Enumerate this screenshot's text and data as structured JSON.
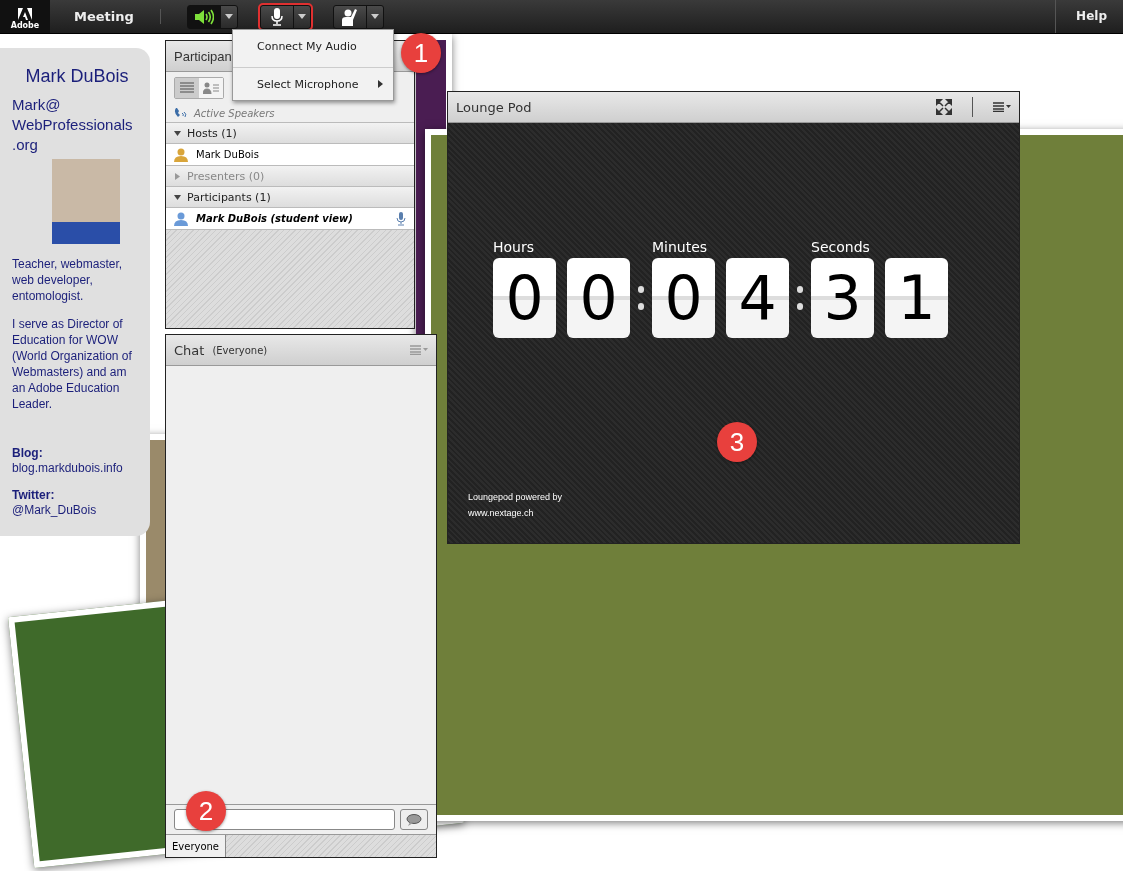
{
  "top_bar": {
    "logo": "Adobe",
    "menu": "Meeting",
    "help": "Help",
    "buttons": [
      {
        "kind": "speaker",
        "on": true,
        "highlighted": false
      },
      {
        "kind": "microphone",
        "on": false,
        "highlighted": true
      },
      {
        "kind": "raise-hand",
        "on": false,
        "highlighted": false
      }
    ]
  },
  "audio_menu": {
    "items": [
      {
        "label": "Connect My Audio",
        "submenu": false
      },
      {
        "label": "Select Microphone",
        "submenu": true
      }
    ]
  },
  "profile": {
    "name": "Mark DuBois",
    "email_lines": [
      "Mark@",
      "WebProfessionals",
      ".org"
    ],
    "roles": "Teacher,  webmaster, web developer, entomologist.",
    "bio": "I serve as Director of Education for WOW (World Organization of Webmasters) and am an Adobe Education Leader.",
    "blog_label": "Blog:",
    "blog": "blog.markdubois.info",
    "twitter_label": "Twitter:",
    "twitter": "@Mark_DuBois"
  },
  "attendees_pod": {
    "title": "Participan",
    "views": [
      {
        "kind": "list",
        "selected": true
      },
      {
        "kind": "card",
        "selected": false
      }
    ],
    "active_speakers": "Active Speakers",
    "groups": [
      {
        "label": "Hosts (1)",
        "expanded": true,
        "members": [
          {
            "name": "Mark DuBois",
            "kind": "host",
            "mic": false
          }
        ]
      },
      {
        "label": "Presenters (0)",
        "expanded": false
      },
      {
        "label": "Participants (1)",
        "expanded": true,
        "members": [
          {
            "name": "Mark DuBois (student view)",
            "kind": "participant",
            "mic": true
          }
        ]
      }
    ]
  },
  "chat_pod": {
    "title": "Chat",
    "audience": "(Everyone)",
    "tabs": [
      {
        "label": "Everyone",
        "selected": true
      }
    ]
  },
  "lounge_pod": {
    "title": "Lounge Pod",
    "units": [
      {
        "label": "Hours",
        "digits": [
          "0",
          "0"
        ]
      },
      {
        "label": "Minutes",
        "digits": [
          "0",
          "4"
        ]
      },
      {
        "label": "Seconds",
        "digits": [
          "3",
          "1"
        ]
      }
    ],
    "footer": [
      "Loungepod powered by",
      "www.nextage.ch"
    ]
  },
  "callouts": [
    "1",
    "2",
    "3"
  ]
}
